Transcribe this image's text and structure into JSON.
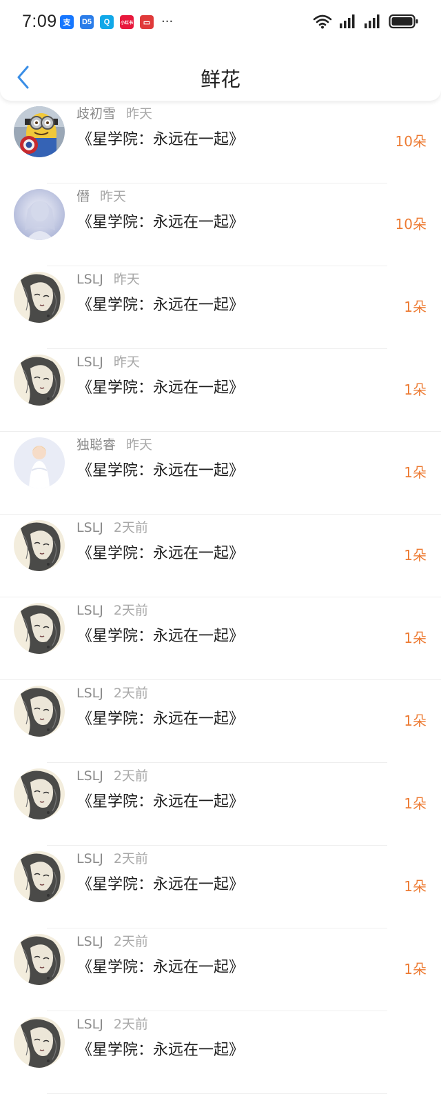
{
  "status_bar": {
    "time": "7:09",
    "apps": [
      {
        "icon": "alipay-icon",
        "glyph": "支",
        "color": "#1677ff"
      },
      {
        "icon": "weather-app-icon",
        "glyph": "D5",
        "color": "#2b7de9"
      },
      {
        "icon": "search-app-icon",
        "glyph": "Q",
        "color": "#11a8e8"
      },
      {
        "icon": "red-app-icon",
        "glyph": "小红书",
        "color": "#e8183c"
      },
      {
        "icon": "red-folder-icon",
        "glyph": "▭",
        "color": "#e03a3a"
      }
    ],
    "more": "···"
  },
  "header": {
    "title": "鲜花"
  },
  "colors": {
    "accent": "#ed7b33",
    "back": "#3a8ee6"
  },
  "items": [
    {
      "name": "歧初雪",
      "time": "昨天",
      "book": "《星学院：永远在一起》",
      "count": "10朵",
      "avatar": "minion-avatar"
    },
    {
      "name": "僭",
      "time": "昨天",
      "book": "《星学院：永远在一起》",
      "count": "10朵",
      "avatar": "girl-blue-avatar"
    },
    {
      "name": "LSLJ",
      "time": "昨天",
      "book": "《星学院：永远在一起》",
      "count": "1朵",
      "avatar": "sketch-girl-avatar"
    },
    {
      "name": "LSLJ",
      "time": "昨天",
      "book": "《星学院：永远在一起》",
      "count": "1朵",
      "avatar": "sketch-girl-avatar"
    },
    {
      "name": "独聪睿",
      "time": "昨天",
      "book": "《星学院：永远在一起》",
      "count": "1朵",
      "avatar": "child-white-avatar"
    },
    {
      "name": "LSLJ",
      "time": "2天前",
      "book": "《星学院：永远在一起》",
      "count": "1朵",
      "avatar": "sketch-girl-avatar"
    },
    {
      "name": "LSLJ",
      "time": "2天前",
      "book": "《星学院：永远在一起》",
      "count": "1朵",
      "avatar": "sketch-girl-avatar"
    },
    {
      "name": "LSLJ",
      "time": "2天前",
      "book": "《星学院：永远在一起》",
      "count": "1朵",
      "avatar": "sketch-girl-avatar"
    },
    {
      "name": "LSLJ",
      "time": "2天前",
      "book": "《星学院：永远在一起》",
      "count": "1朵",
      "avatar": "sketch-girl-avatar"
    },
    {
      "name": "LSLJ",
      "time": "2天前",
      "book": "《星学院：永远在一起》",
      "count": "1朵",
      "avatar": "sketch-girl-avatar"
    },
    {
      "name": "LSLJ",
      "time": "2天前",
      "book": "《星学院：永远在一起》",
      "count": "1朵",
      "avatar": "sketch-girl-avatar"
    },
    {
      "name": "LSLJ",
      "time": "2天前",
      "book": "《星学院：永远在一起》",
      "count": "",
      "avatar": "sketch-girl-avatar"
    }
  ]
}
